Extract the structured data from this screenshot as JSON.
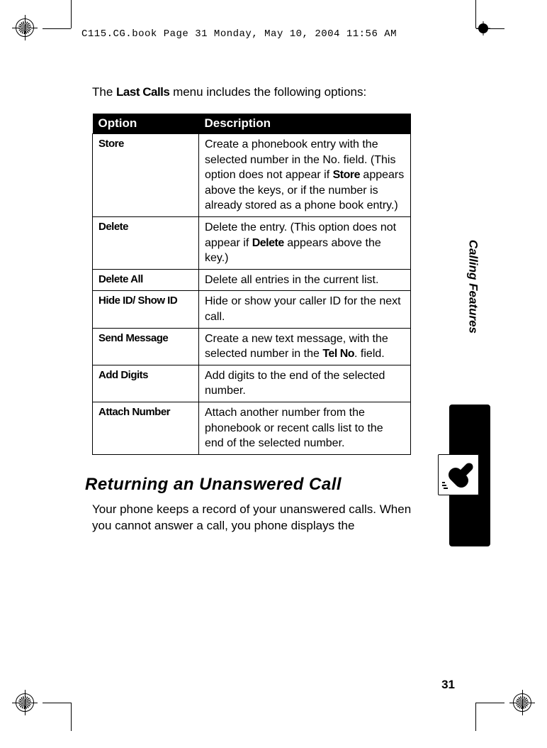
{
  "header": "C115.CG.book  Page 31  Monday, May 10, 2004  11:56 AM",
  "intro_pre": "The ",
  "intro_bold": "Last Calls",
  "intro_post": " menu includes the following options:",
  "table": {
    "h1": "Option",
    "h2": "Description",
    "rows": [
      {
        "opt": "Store",
        "desc_pre": "Create a phonebook entry with the selected number in the No. field. (This option does not appear if ",
        "desc_bold": "Store",
        "desc_post": " appears above the keys, or if the number is already stored as a phone book entry.)"
      },
      {
        "opt": "Delete",
        "desc_pre": "Delete the entry. (This option does not appear if ",
        "desc_bold": "Delete",
        "desc_post": " appears above the key.)"
      },
      {
        "opt": "Delete All",
        "desc_pre": "Delete all entries in the current list.",
        "desc_bold": "",
        "desc_post": ""
      },
      {
        "opt": "Hide ID/ Show ID",
        "desc_pre": "Hide or show your caller ID for the next call.",
        "desc_bold": "",
        "desc_post": ""
      },
      {
        "opt": "Send Message",
        "desc_pre": "Create a new text message, with the selected number in the ",
        "desc_bold": "Tel No",
        "desc_post": ". field."
      },
      {
        "opt": "Add Digits",
        "desc_pre": "Add digits to the end of the selected number.",
        "desc_bold": "",
        "desc_post": ""
      },
      {
        "opt": "Attach Number",
        "desc_pre": "Attach another number from the phonebook or recent calls list to the end of the selected number.",
        "desc_bold": "",
        "desc_post": ""
      }
    ]
  },
  "section_heading": "Returning an Unanswered Call",
  "section_para": "Your phone keeps a record of your unanswered calls. When you cannot answer a call, you phone displays the",
  "side_label": "Calling Features",
  "page_number": "31"
}
